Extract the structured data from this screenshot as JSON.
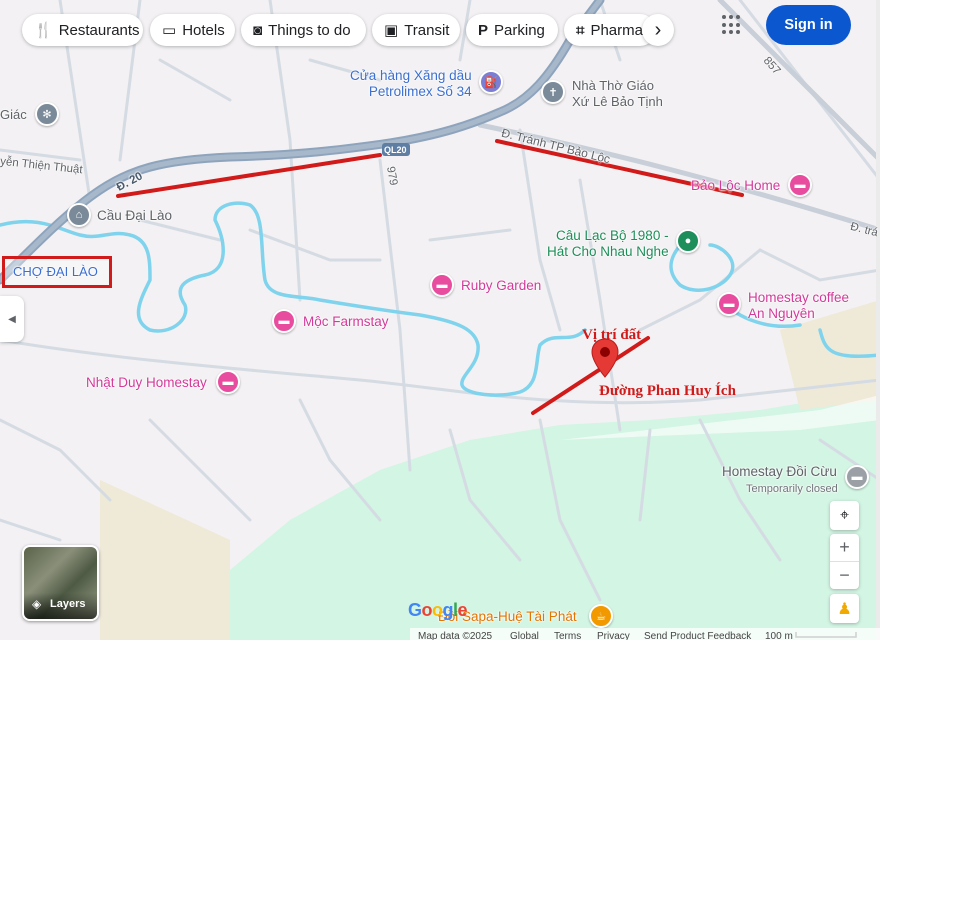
{
  "filters": {
    "restaurants": "Restaurants",
    "hotels": "Hotels",
    "things_to_do": "Things to do",
    "transit": "Transit",
    "parking": "Parking",
    "pharmacies": "Pharma"
  },
  "header": {
    "sign_in": "Sign in"
  },
  "road_labels": {
    "d20": "Đ. 20",
    "ql20": "QL20",
    "r979": "979",
    "r857": "857",
    "tranh_tp": "Đ. Tránh TP Bảo Lộc",
    "tranh_tp_short": "Đ. trá",
    "nguyen_thien_thuat": "yễn Thiện Thuật"
  },
  "places": {
    "petrolimex": "Cửa hàng Xăng dầu\nPetrolimex Số 34",
    "petrolimex_line1": "Cửa hàng Xăng dầu",
    "petrolimex_line2": "Petrolimex Số 34",
    "church_line1": "Nhà Thờ Giáo",
    "church_line2": "Xứ Lê Bảo Tịnh",
    "giac": "Giác",
    "cau_dai_lao": "Cầu Đại Lào",
    "cho_dai_lao": "CHỢ ĐẠI LÀO",
    "bao_loc_home": "Bảo Lộc Home",
    "club_line1": "Câu Lạc Bộ 1980 -",
    "club_line2": "Hát Cho Nhau Nghe",
    "ruby_garden": "Ruby Garden",
    "moc_farmstay": "Mộc Farmstay",
    "homestay_coffee_line1": "Homestay coffee",
    "homestay_coffee_line2": "An Nguyên",
    "nhat_duy": "Nhật Duy Homestay",
    "homestay_doi_cu": "Homestay Đồi Cừu",
    "temporarily_closed": "Temporarily closed",
    "sapa_hue": "Đồi Sapa-Huệ Tài Phát"
  },
  "annotations": {
    "vi_tri_dat": "Vị trí đất",
    "duong_phan_huy_ich": "Đường Phan Huy Ích"
  },
  "controls": {
    "layers": "Layers"
  },
  "footer": {
    "logo": "Google",
    "map_data": "Map data ©2025",
    "global": "Global",
    "terms": "Terms",
    "privacy": "Privacy",
    "feedback": "Send Product Feedback",
    "scale": "100 m"
  },
  "colors": {
    "land": "#f3f1f3",
    "forest": "#d3f5e3",
    "river": "#7fd3ec",
    "highway": "#8ea4bd",
    "road": "#d5dbe3",
    "annotation_red": "#d11a1a",
    "pin_pink": "#e84c9f",
    "sign_in_blue": "#0b57d0"
  }
}
